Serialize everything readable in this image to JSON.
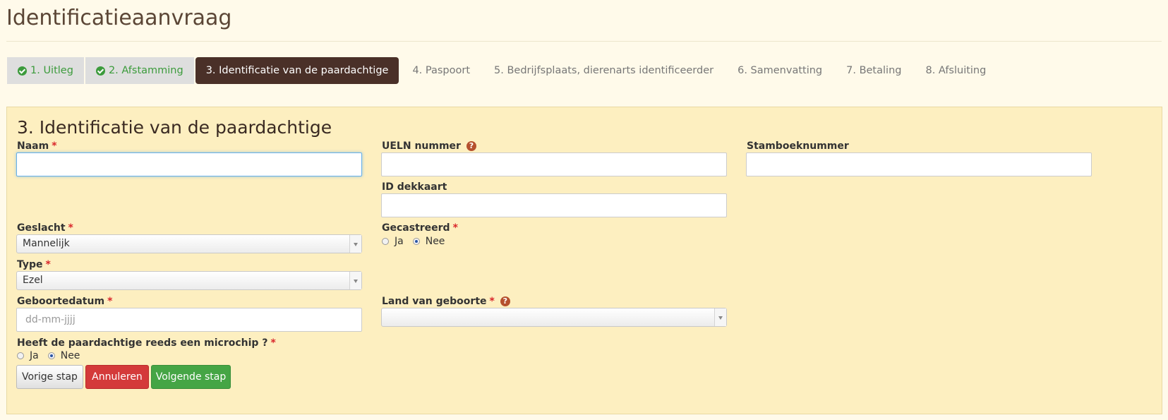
{
  "page": {
    "title": "Identificatieaanvraag"
  },
  "steps": [
    {
      "label": "1. Uitleg",
      "state": "done"
    },
    {
      "label": "2. Afstamming",
      "state": "done"
    },
    {
      "label": "3. Identificatie van de paardachtige",
      "state": "active"
    },
    {
      "label": "4. Paspoort",
      "state": "todo"
    },
    {
      "label": "5. Bedrijfsplaats, dierenarts identificeerder",
      "state": "todo"
    },
    {
      "label": "6. Samenvatting",
      "state": "todo"
    },
    {
      "label": "7. Betaling",
      "state": "todo"
    },
    {
      "label": "8. Afsluiting",
      "state": "todo"
    }
  ],
  "form": {
    "title": "3. Identificatie van de paardachtige",
    "required_mark": "*",
    "naam": {
      "label": "Naam",
      "value": ""
    },
    "ueln": {
      "label": "UELN nummer",
      "value": "",
      "help": "?"
    },
    "stamboek": {
      "label": "Stamboeknummer",
      "value": ""
    },
    "dekkaart": {
      "label": "ID dekkaart",
      "value": ""
    },
    "geslacht": {
      "label": "Geslacht",
      "selected": "Mannelijk"
    },
    "gecastreerd": {
      "label": "Gecastreerd",
      "options": [
        "Ja",
        "Nee"
      ],
      "selected": "Nee"
    },
    "type": {
      "label": "Type",
      "selected": "Ezel"
    },
    "geboortedatum": {
      "label": "Geboortedatum",
      "value": "",
      "placeholder": "dd-mm-jjjj"
    },
    "land": {
      "label": "Land van geboorte",
      "selected": "",
      "help": "?"
    },
    "microchip": {
      "label": "Heeft de paardachtige reeds een microchip ?",
      "options": [
        "Ja",
        "Nee"
      ],
      "selected": "Nee"
    }
  },
  "buttons": {
    "previous": "Vorige stap",
    "cancel": "Annuleren",
    "next": "Volgende stap"
  },
  "colors": {
    "background": "#fffaea",
    "panel": "#fdefc0",
    "active_step": "#4a3028",
    "done_step": "#3c9b3c",
    "required": "#d9262a",
    "cancel": "#d43a3a",
    "next": "#45a545"
  }
}
